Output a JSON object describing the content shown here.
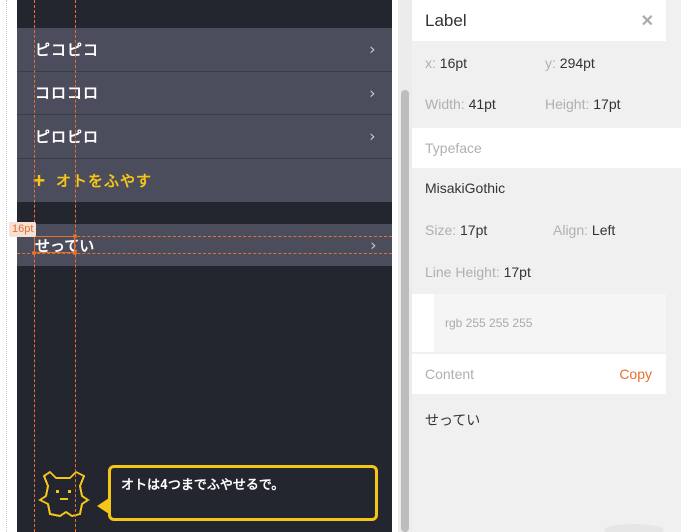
{
  "app": {
    "menu_items": [
      {
        "label": "ピコピコ",
        "chevron": "›"
      },
      {
        "label": "コロコロ",
        "chevron": "›"
      },
      {
        "label": "ピロピロ",
        "chevron": "›"
      }
    ],
    "add_sound": {
      "icon": "+",
      "label": "オトをふやす"
    },
    "settings": {
      "label": "せってい",
      "chevron": "›"
    },
    "bubble_text": "オトは4つまでふやせるで。",
    "accent_color": "#f5c518",
    "background_color": "#24262f",
    "row_color": "#4b4d5c"
  },
  "selection": {
    "dimension_badge": "16pt"
  },
  "inspector": {
    "title": "Label",
    "close_glyph": "✕",
    "x_label": "x:",
    "x_value": "16pt",
    "y_label": "y:",
    "y_value": "294pt",
    "width_label": "Width:",
    "width_value": "41pt",
    "height_label": "Height:",
    "height_value": "17pt",
    "typeface_header": "Typeface",
    "typeface_name": "MisakiGothic",
    "size_label": "Size:",
    "size_value": "17pt",
    "align_label": "Align:",
    "align_value": "Left",
    "line_height_label": "Line Height:",
    "line_height_value": "17pt",
    "color_value": "rgb 255 255 255",
    "content_header": "Content",
    "copy_label": "Copy",
    "content_value": "せってい",
    "accent_color": "#e8702a"
  }
}
